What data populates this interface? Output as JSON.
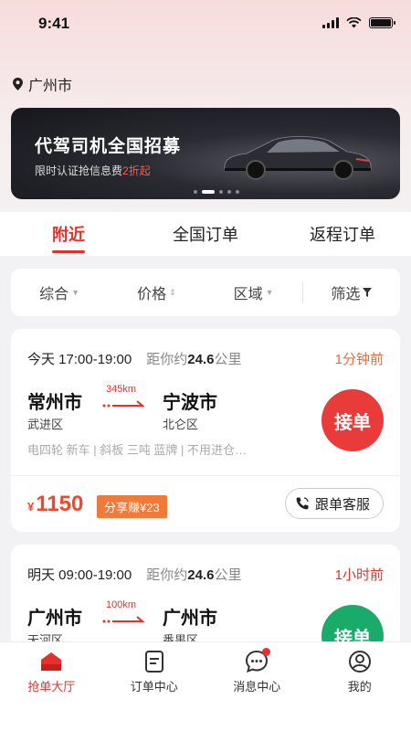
{
  "status_bar": {
    "time": "9:41"
  },
  "location": {
    "city": "广州市",
    "icon": "location-pin-icon"
  },
  "banner": {
    "title": "代驾司机全国招募",
    "subtitle_prefix": "限时认证抢信息费",
    "subtitle_highlight": "2折起",
    "highlight_color": "#ff5a4a"
  },
  "tabs": [
    {
      "label": "附近",
      "active": true
    },
    {
      "label": "全国订单",
      "active": false
    },
    {
      "label": "返程订单",
      "active": false
    }
  ],
  "filters": [
    {
      "label": "综合"
    },
    {
      "label": "价格"
    },
    {
      "label": "区域"
    },
    {
      "label": "筛选"
    }
  ],
  "orders": [
    {
      "time": "今天 17:00-19:00",
      "distance_prefix": "距你约",
      "distance_value": "24.6",
      "distance_unit": "公里",
      "ago": "1分钟前",
      "from_city": "常州市",
      "from_district": "武进区",
      "route_km": "345km",
      "to_city": "宁波市",
      "to_district": "北仑区",
      "tags": "电四轮 新车 | 斜板 三吨 蓝牌 | 不用进仓…",
      "accept_label": "接单",
      "price_symbol": "¥",
      "price": "1150",
      "share_label": "分享赚¥23",
      "service_label": "跟单客服"
    },
    {
      "time": "明天 09:00-19:00",
      "distance_prefix": "距你约",
      "distance_value": "24.6",
      "distance_unit": "公里",
      "ago": "1小时前",
      "from_city": "广州市",
      "from_district": "天河区",
      "route_km": "100km",
      "to_city": "广州市",
      "to_district": "番禺区",
      "accept_label": "接单"
    }
  ],
  "bottom_nav": [
    {
      "label": "抢单大厅",
      "icon": "hall-icon",
      "active": true
    },
    {
      "label": "订单中心",
      "icon": "order-list-icon",
      "active": false
    },
    {
      "label": "消息中心",
      "icon": "message-icon",
      "active": false,
      "badge": true
    },
    {
      "label": "我的",
      "icon": "profile-icon",
      "active": false
    }
  ],
  "colors": {
    "accent": "#e5312c",
    "price": "#ee4a2a",
    "accept_red": "#ea3b3b",
    "accept_green": "#1aaa6a"
  }
}
